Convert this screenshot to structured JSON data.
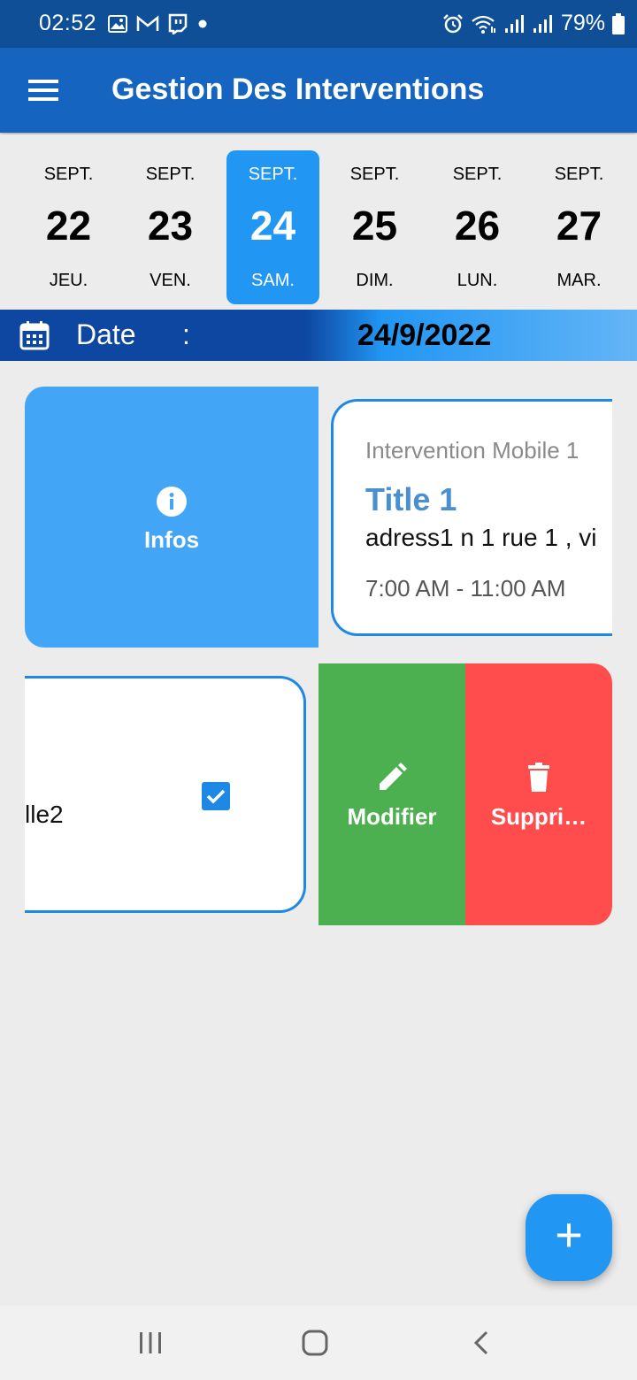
{
  "status_bar": {
    "time": "02:52",
    "battery_percent": "79%",
    "left_icons": [
      "image-icon",
      "gmail-icon",
      "twitch-icon",
      "dot-icon"
    ],
    "right_icons": [
      "alarm-icon",
      "wifi-icon",
      "signal-icon",
      "signal-icon",
      "battery-icon"
    ]
  },
  "app_bar": {
    "title": "Gestion Des Interventions",
    "menu_icon": "menu-icon"
  },
  "date_strip": {
    "days": [
      {
        "month": "SEPT.",
        "day": "22",
        "weekday": "JEU.",
        "selected": false
      },
      {
        "month": "SEPT.",
        "day": "23",
        "weekday": "VEN.",
        "selected": false
      },
      {
        "month": "SEPT.",
        "day": "24",
        "weekday": "SAM.",
        "selected": true
      },
      {
        "month": "SEPT.",
        "day": "25",
        "weekday": "DIM.",
        "selected": false
      },
      {
        "month": "SEPT.",
        "day": "26",
        "weekday": "LUN.",
        "selected": false
      },
      {
        "month": "SEPT.",
        "day": "27",
        "weekday": "MAR.",
        "selected": false
      }
    ]
  },
  "date_bar": {
    "label": "Date",
    "colon": ":",
    "value": "24/9/2022"
  },
  "interventions": [
    {
      "subtitle": "Intervention Mobile 1",
      "title": "Title 1",
      "address": "adress1 n 1 rue 1 , vi",
      "time": "7:00 AM - 11:00 AM",
      "actions": {
        "infos": "Infos"
      }
    },
    {
      "text": "lle2",
      "checked": true,
      "actions": {
        "modify": "Modifier",
        "delete": "Suppri…"
      }
    }
  ],
  "fab": {
    "label": "+"
  },
  "colors": {
    "status_bar": "#0f4f98",
    "app_bar": "#1565c0",
    "accent": "#2196f3",
    "modify": "#4caf50",
    "delete": "#ff4d4d",
    "background": "#ececec"
  }
}
